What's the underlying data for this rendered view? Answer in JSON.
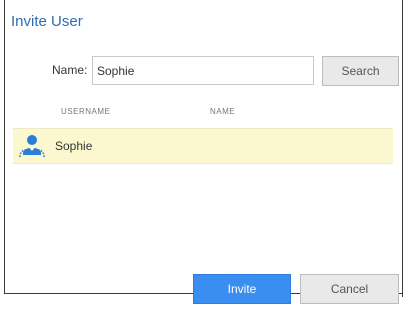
{
  "dialog": {
    "title": "Invite User"
  },
  "search": {
    "label": "Name:",
    "value": "Sophie",
    "button_label": "Search"
  },
  "table": {
    "columns": [
      "USERNAME",
      "NAME"
    ],
    "rows": [
      {
        "username": "Sophie",
        "name": "",
        "icon": "user-group-icon",
        "selected": true
      }
    ]
  },
  "actions": {
    "invite_label": "Invite",
    "cancel_label": "Cancel"
  },
  "colors": {
    "title": "#2d6db0",
    "primary_button": "#3a8ef0",
    "selected_row": "#fbf8cf",
    "user_icon": "#2a7fd4"
  }
}
